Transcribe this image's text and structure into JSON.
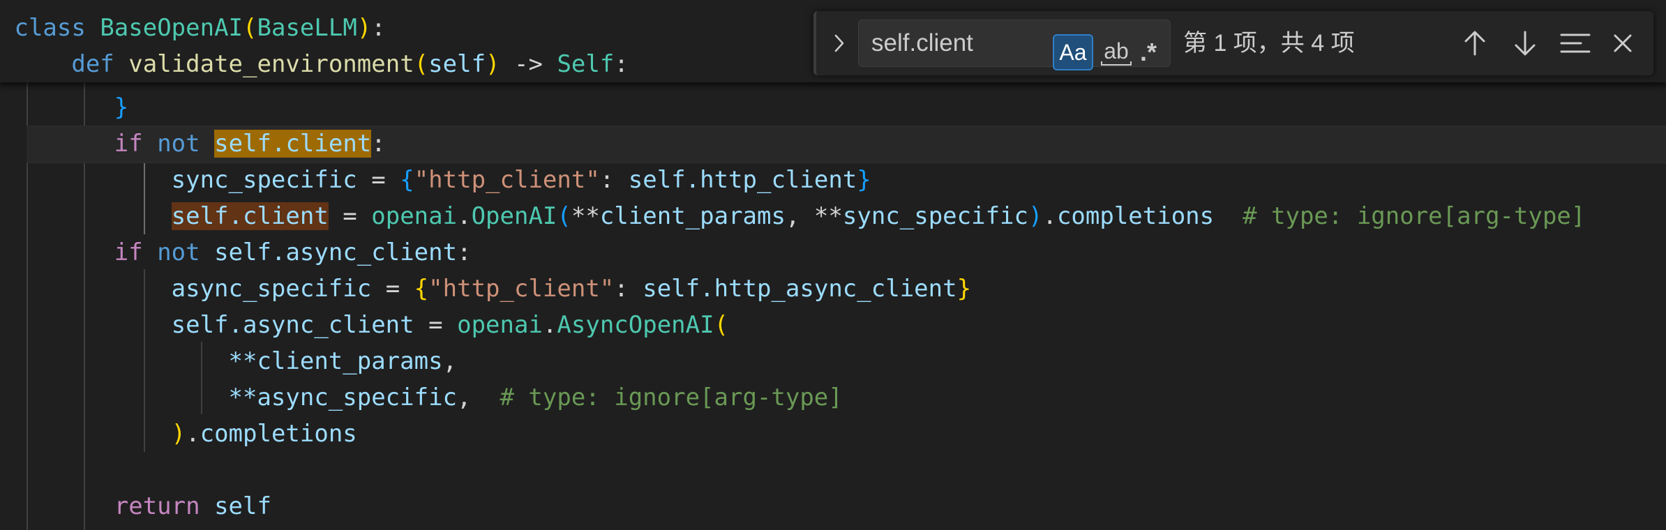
{
  "editor": {
    "sticky": {
      "class_kw": "class",
      "class_name": "BaseOpenAI",
      "class_base": "BaseLLM",
      "def_kw": "def",
      "def_name": "validate_environment",
      "def_param": "self",
      "def_arrow": "->",
      "def_ret": "Self"
    },
    "lines": {
      "close_brace": "}",
      "if1_kw": "if",
      "if1_not": "not",
      "if1_match": "self.client",
      "sync_var": "sync_specific",
      "sync_key": "\"http_client\"",
      "sync_val": "self.http_client",
      "assign_match": "self.client",
      "openai": "openai",
      "openai_cls": "OpenAI",
      "star1": "**",
      "client_params": "client_params",
      "star2": "**",
      "sync_specific": "sync_specific",
      "completions": "completions",
      "comment1": "# type: ignore[arg-type]",
      "if2_kw": "if",
      "if2_not": "not",
      "if2_target": "self.async_client",
      "async_var": "async_specific",
      "async_key": "\"http_client\"",
      "async_val": "self.http_async_client",
      "async_assign": "self.async_client",
      "openai2": "openai",
      "async_cls": "AsyncOpenAI",
      "arg1": "**client_params",
      "arg2": "**async_specific",
      "comment2": "# type: ignore[arg-type]",
      "completions2": "completions",
      "return_kw": "return",
      "return_val": "self"
    }
  },
  "find_widget": {
    "query": "self.client",
    "match_case_label": "Aa",
    "whole_word_label": "ab",
    "regex_label": ".*",
    "match_count": "第 1 项，共 4 项",
    "icons": [
      "chevron-right-icon",
      "arrow-up-icon",
      "arrow-down-icon",
      "find-in-selection-icon",
      "close-icon"
    ]
  },
  "colors": {
    "background": "#1f1f1f",
    "current_match": "#9e6a03",
    "other_match": "#623315",
    "keyword": "#569cd6",
    "control": "#c586c0",
    "class_name": "#4ec9b0",
    "function": "#dcdcaa",
    "string": "#ce9178",
    "comment": "#6a9955",
    "bracket_gold": "#ffd700",
    "toggle_active": "#1f4f7a"
  }
}
